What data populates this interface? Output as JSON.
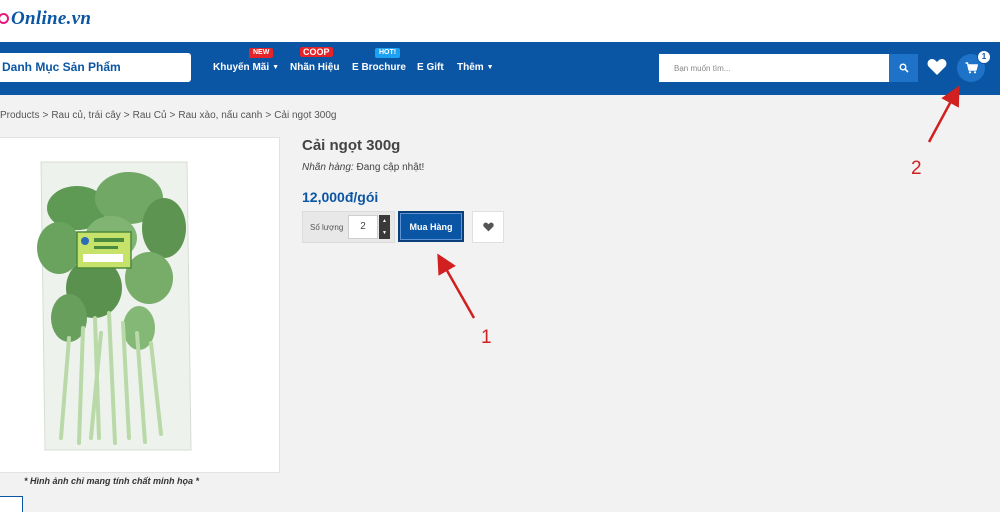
{
  "header": {
    "logo_text": "Online.vn"
  },
  "navbar": {
    "category_label": "Danh Mục Sản Phẩm",
    "items": [
      {
        "label": "Khuyến Mãi",
        "badge": "NEW",
        "has_dropdown": true
      },
      {
        "label": "Nhãn Hiệu",
        "badge": "COOP",
        "has_dropdown": false
      },
      {
        "label": "E Brochure",
        "badge": "HOT!",
        "has_dropdown": false
      },
      {
        "label": "E Gift",
        "badge": "",
        "has_dropdown": false
      },
      {
        "label": "Thêm",
        "badge": "",
        "has_dropdown": true
      }
    ],
    "search_placeholder": "Bạn muốn tìm...",
    "cart_count": "1"
  },
  "breadcrumb": {
    "items": [
      "Products",
      "Rau củ, trái cây",
      "Rau Củ",
      "Rau xào, nấu canh",
      "Cải ngọt 300g"
    ],
    "separator": ">"
  },
  "product": {
    "title": "Cải ngọt 300g",
    "brand_label": "Nhãn hàng:",
    "brand_value": "Đang cập nhật!",
    "price": "12,000đ/gói",
    "quantity_label": "Số lượng",
    "quantity_value": "2",
    "buy_label": "Mua Hàng",
    "image_caption": "* Hình ảnh chỉ mang tính chất minh họa *"
  },
  "annotations": {
    "arrow_1_label": "1",
    "arrow_2_label": "2",
    "color": "#d02020"
  },
  "colors": {
    "brand_blue": "#0b56a4",
    "accent_blue": "#1e73c9",
    "badge_red": "#e52429",
    "badge_blue": "#1da1f2",
    "logo_pink": "#e5197b"
  }
}
